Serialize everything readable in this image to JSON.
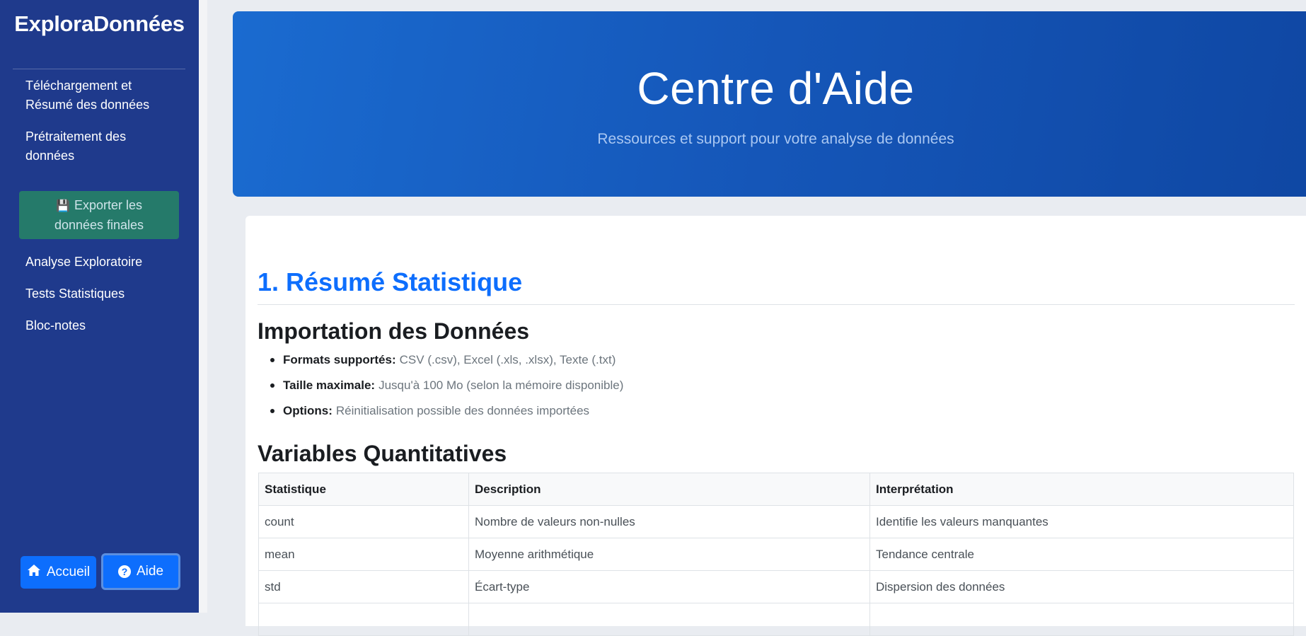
{
  "sidebar": {
    "brand": "ExploraDonnées",
    "items": [
      {
        "label": "Téléchargement et Résumé des données"
      },
      {
        "label": "Prétraitement des données"
      },
      {
        "label": "Exporter les données finales"
      },
      {
        "label": "Analyse Exploratoire"
      },
      {
        "label": "Tests Statistiques"
      },
      {
        "label": "Bloc-notes"
      }
    ],
    "home_label": "Accueil",
    "help_label": "Aide",
    "export_icon": "floppy-disk-icon",
    "home_icon": "house-icon",
    "help_icon": "question-circle-icon"
  },
  "hero": {
    "title": "Centre d'Aide",
    "subtitle": "Ressources et support pour votre analyse de données"
  },
  "content": {
    "section_title": "1. Résumé Statistique",
    "import": {
      "heading": "Importation des Données",
      "bullets": [
        {
          "label": "Formats supportés:",
          "text": "CSV (.csv), Excel (.xls, .xlsx), Texte (.txt)"
        },
        {
          "label": "Taille maximale:",
          "text": "Jusqu'à 100 Mo (selon la mémoire disponible)"
        },
        {
          "label": "Options:",
          "text": "Réinitialisation possible des données importées"
        }
      ]
    },
    "quant": {
      "heading": "Variables Quantitatives",
      "columns": [
        "Statistique",
        "Description",
        "Interprétation"
      ],
      "rows": [
        [
          "count",
          "Nombre de valeurs non-nulles",
          "Identifie les valeurs manquantes"
        ],
        [
          "mean",
          "Moyenne arithmétique",
          "Tendance centrale"
        ],
        [
          "std",
          "Écart-type",
          "Dispersion des données"
        ],
        [
          "",
          "",
          ""
        ]
      ]
    }
  },
  "colors": {
    "sidebar": "#1f3a8c",
    "primary": "#0d6efd",
    "export": "#257a6a",
    "hero": "#1556b8"
  }
}
